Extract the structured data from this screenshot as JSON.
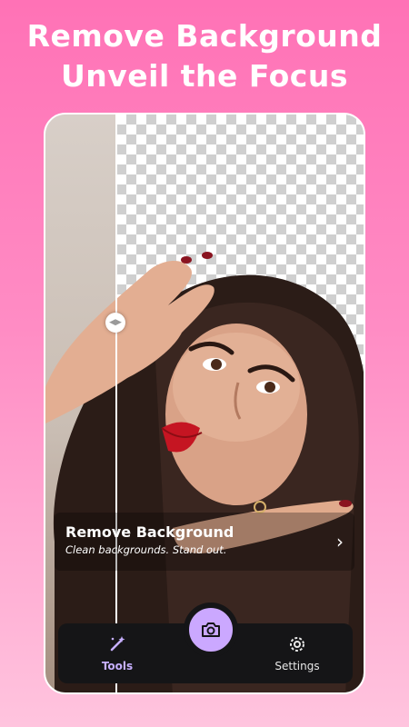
{
  "headline": {
    "line1": "Remove Background",
    "line2": "Unveil the Focus"
  },
  "card": {
    "title": "Remove Background",
    "subtitle": "Clean backgrounds. Stand out.",
    "arrow_icon": "chevron-right-icon"
  },
  "divider": {
    "icon": "split-arrows-icon"
  },
  "tabs": {
    "tools_label": "Tools",
    "settings_label": "Settings",
    "tools_icon": "magic-wand-icon",
    "settings_icon": "gear-icon",
    "camera_icon": "camera-icon"
  },
  "colors": {
    "accent": "#cba8ff",
    "tab_active": "#c7b0ff",
    "tab_bar_bg": "#151517",
    "background_top": "#ff72b6",
    "background_bottom": "#ffc4de"
  }
}
